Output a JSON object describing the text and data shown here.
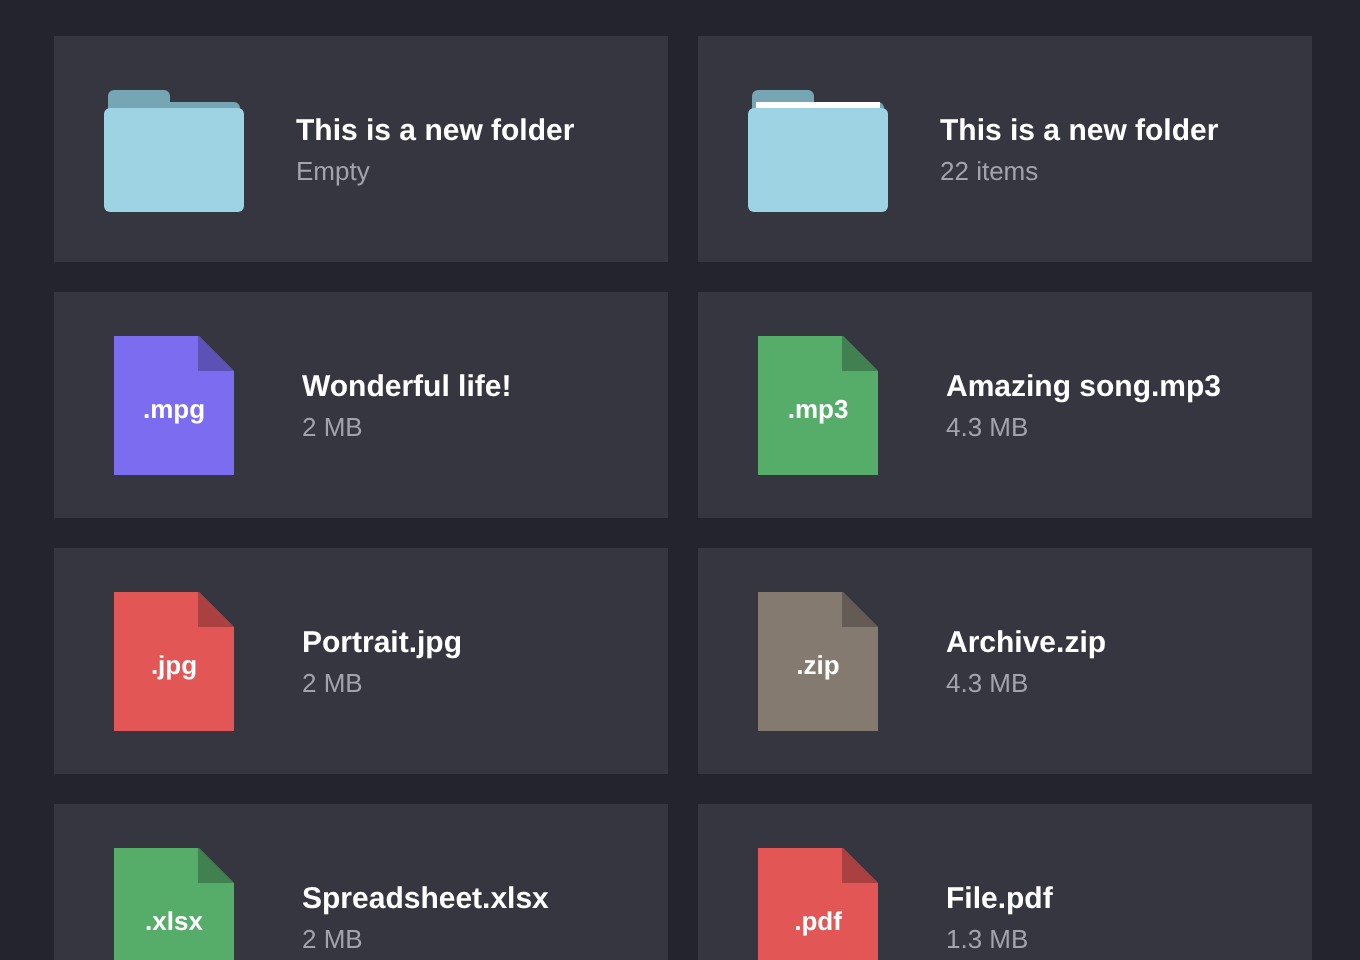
{
  "items": [
    {
      "kind": "folder",
      "filled": false,
      "name": "This is a new folder",
      "detail": "Empty"
    },
    {
      "kind": "folder",
      "filled": true,
      "name": "This is a new folder",
      "detail": "22 items"
    },
    {
      "kind": "file",
      "extension": ".mpg",
      "color": "#7b6cf0",
      "name": "Wonderful life!",
      "detail": "2 MB"
    },
    {
      "kind": "file",
      "extension": ".mp3",
      "color": "#56ad6a",
      "name": "Amazing song.mp3",
      "detail": "4.3 MB"
    },
    {
      "kind": "file",
      "extension": ".jpg",
      "color": "#e35656",
      "name": "Portrait.jpg",
      "detail": "2 MB"
    },
    {
      "kind": "file",
      "extension": ".zip",
      "color": "#857a70",
      "name": "Archive.zip",
      "detail": "4.3 MB"
    },
    {
      "kind": "file",
      "extension": ".xlsx",
      "color": "#56ad6a",
      "name": "Spreadsheet.xlsx",
      "detail": "2 MB"
    },
    {
      "kind": "file",
      "extension": ".pdf",
      "color": "#e35656",
      "name": "File.pdf",
      "detail": "1.3 MB"
    }
  ]
}
